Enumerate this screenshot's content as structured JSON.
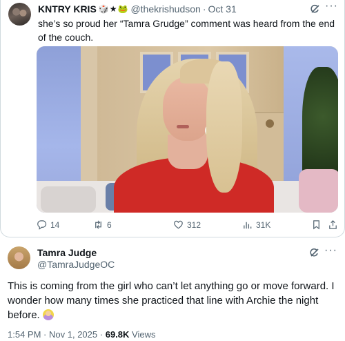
{
  "quoted": {
    "author_name": "KNTRY KRIS",
    "author_emoji": "🎲★🐸",
    "handle": "@thekrishudson",
    "separator": "·",
    "date": "Oct 31",
    "text": "she’s so proud her “Tamra Grudge” comment was heard from the end of the couch.",
    "actions": {
      "replies": "14",
      "retweets": "6",
      "likes": "312",
      "views": "31K"
    }
  },
  "main": {
    "author_name": "Tamra Judge",
    "handle": "@TamraJudgeOC",
    "text": "This is coming from the girl who can’t let anything go or move forward. I wonder how many times she practiced line with Archie the night before.",
    "text_display": "This is coming from the girl who can’t let anything go or move forward. I wonder how many times she practiced that line with Archie the night before.",
    "emoji_name": "woman-tipping-hand-emoji",
    "time": "1:54 PM",
    "date": "Nov 1, 2025",
    "views_count": "69.8K",
    "views_label": "Views",
    "separator": "·"
  },
  "more_glyph": "···",
  "icons": [
    "grok-icon",
    "more-icon",
    "reply-icon",
    "retweet-icon",
    "like-icon",
    "views-icon",
    "bookmark-icon",
    "share-icon"
  ]
}
